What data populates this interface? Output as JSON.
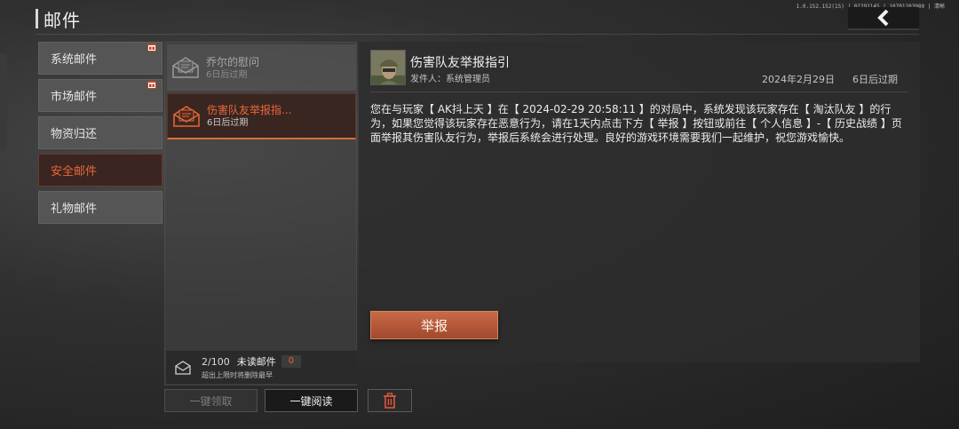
{
  "header": {
    "title": "邮件",
    "version": "1.0.152.152(15) | 02292145 | 10701203900 | 清晰"
  },
  "categories": [
    {
      "label": "系统邮件",
      "gift": true
    },
    {
      "label": "市场邮件",
      "gift": true
    },
    {
      "label": "物资归还",
      "gift": false
    },
    {
      "label": "安全邮件",
      "gift": false,
      "active": true
    },
    {
      "label": "礼物邮件",
      "gift": false
    }
  ],
  "mails": [
    {
      "title": "乔尔的慰问",
      "expire": "6日后过期",
      "state": "read"
    },
    {
      "title": "伤害队友举报指...",
      "expire": "6日后过期",
      "state": "selected"
    }
  ],
  "footer": {
    "count": "2/100",
    "unread_label": "未读邮件",
    "unread_count": "0",
    "hint": "超出上限时将删除最早"
  },
  "buttons": {
    "claim_all": "一键领取",
    "read_all": "一键阅读"
  },
  "detail": {
    "title": "伤害队友举报指引",
    "sender": "发件人：系统管理员",
    "date": "2024年2月29日",
    "expire": "6日后过期",
    "body": "您在与玩家【 AK抖上天 】在【 2024-02-29 20:58:11 】的对局中，系统发现该玩家存在【 淘汰队友 】的行为，如果您觉得该玩家存在恶意行为，请在1天内点击下方【 举报 】按钮或前往【 个人信息 】-【 历史战绩 】页面举报其伤害队友行为，举报后系统会进行处理。良好的游戏环境需要我们一起维护，祝您游戏愉快。",
    "report_button": "举报"
  },
  "colors": {
    "accent": "#e8673a",
    "report_button": "#b85a3a",
    "panel": "#2d2d2d"
  },
  "icons": {
    "back": "chevron-left-icon",
    "mail": "envelope-icon",
    "gift": "gift-icon",
    "delete": "trash-icon",
    "footer": "mailbox-icon"
  }
}
